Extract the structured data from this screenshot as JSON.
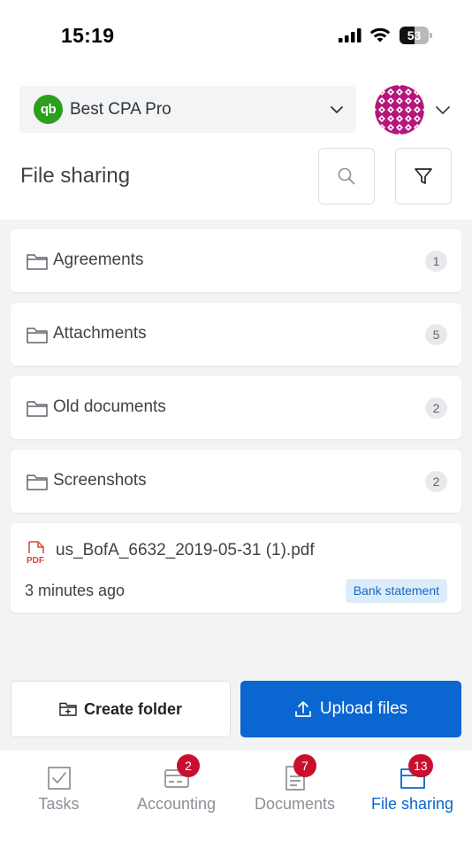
{
  "status_bar": {
    "time": "15:19",
    "battery": "53",
    "battery_level": 0.53
  },
  "header": {
    "company_logo_text": "qb",
    "company_name": "Best CPA Pro",
    "page_title": "File sharing"
  },
  "folders": [
    {
      "name": "Agreements",
      "count": "1"
    },
    {
      "name": "Attachments",
      "count": "5"
    },
    {
      "name": "Old documents",
      "count": "2"
    },
    {
      "name": "Screenshots",
      "count": "2"
    }
  ],
  "file": {
    "icon_text": "PDF",
    "name": "us_BofA_6632_2019-05-31 (1).pdf",
    "time": "3 minutes ago",
    "tag": "Bank statement"
  },
  "actions": {
    "create_folder": "Create folder",
    "upload_files": "Upload files"
  },
  "nav": [
    {
      "label": "Tasks",
      "badge": ""
    },
    {
      "label": "Accounting",
      "badge": "2"
    },
    {
      "label": "Documents",
      "badge": "7"
    },
    {
      "label": "File sharing",
      "badge": "13"
    }
  ],
  "colors": {
    "accent": "#0a66d0",
    "badge": "#c8102e",
    "qb_green": "#2ca01c",
    "tag_bg": "#dcecfb"
  }
}
